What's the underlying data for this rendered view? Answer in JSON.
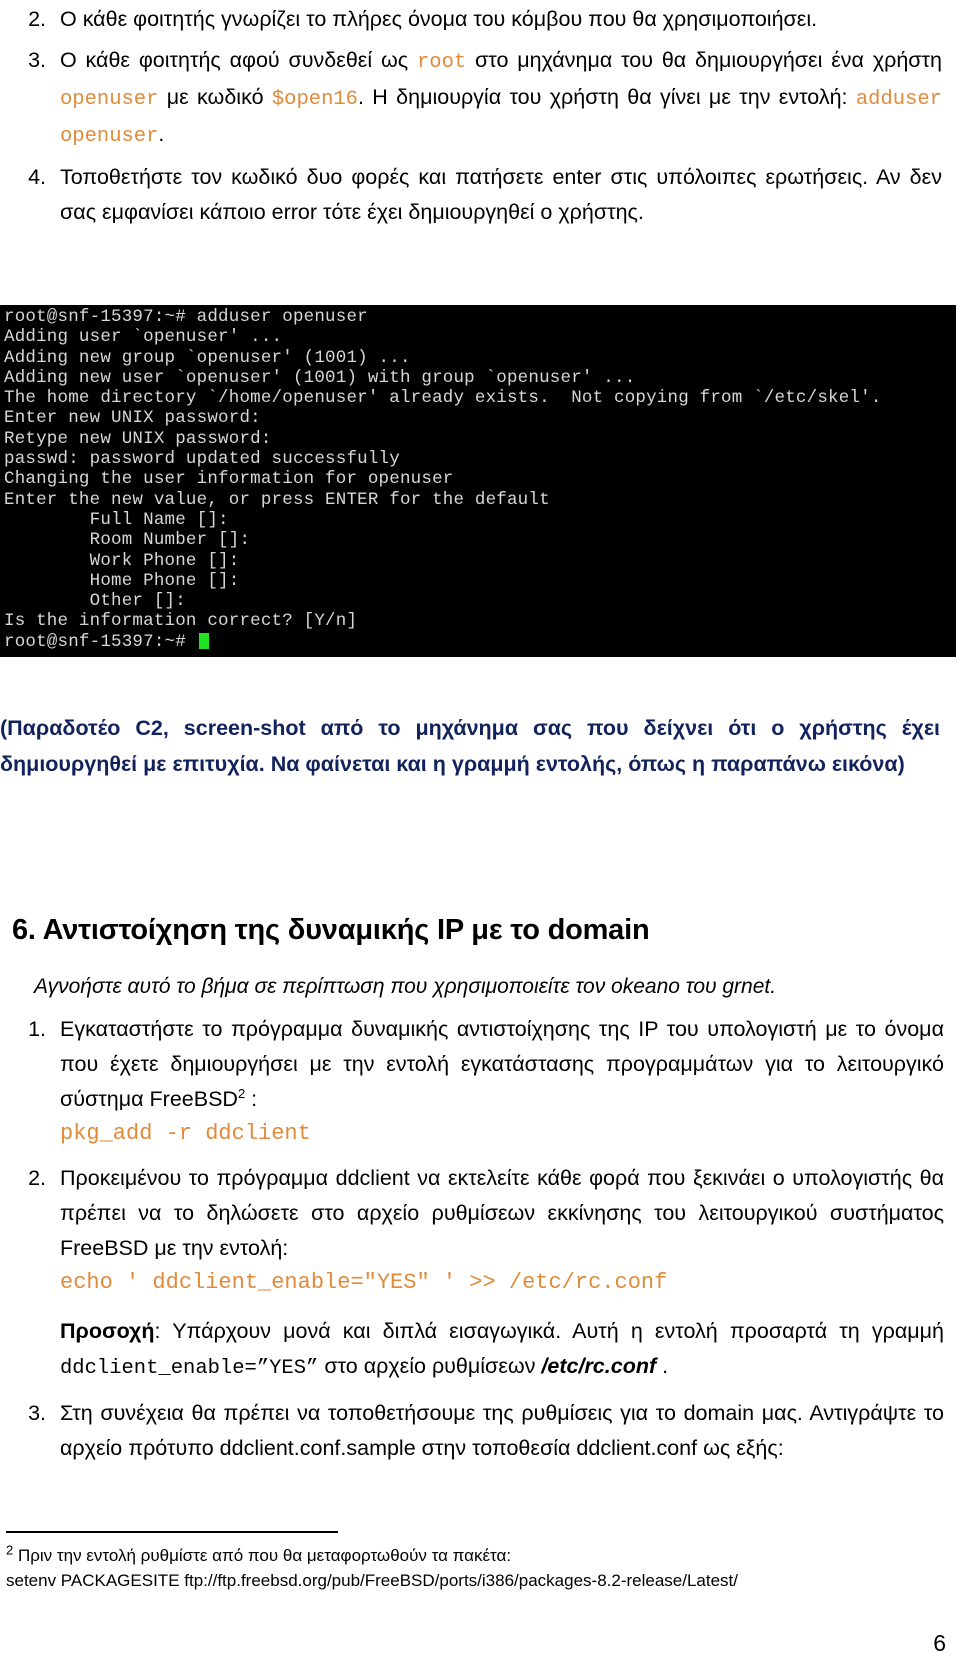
{
  "intro_list": [
    {
      "marker": "2.",
      "parts": [
        {
          "t": "Ο κάθε φοιτητής γνωρίζει το πλήρες όνομα του κόμβου που θα χρησιμοποιήσει.",
          "style": "plain"
        }
      ]
    },
    {
      "marker": "3.",
      "parts": [
        {
          "t": "Ο κάθε φοιτητής αφού συνδεθεί ως ",
          "style": "plain"
        },
        {
          "t": "root",
          "style": "code"
        },
        {
          "t": " στο μηχάνημα του θα δημιουργήσει ένα χρήστη ",
          "style": "plain"
        },
        {
          "t": "openuser",
          "style": "code"
        },
        {
          "t": " με κωδικό ",
          "style": "plain"
        },
        {
          "t": "$open16",
          "style": "code"
        },
        {
          "t": ".  Η δημιουργία του χρήστη θα γίνει με την εντολή: ",
          "style": "plain"
        },
        {
          "t": "adduser openuser",
          "style": "code"
        },
        {
          "t": ".",
          "style": "plain"
        }
      ]
    },
    {
      "marker": "4.",
      "parts": [
        {
          "t": "Τοποθετήστε τον κωδικό δυο φορές και πατήσετε enter στις υπόλοιπες ερωτήσεις. Αν δεν σας εμφανίσει κάποιο error τότε έχει δημιουργηθεί ο χρήστης.",
          "style": "plain"
        }
      ]
    }
  ],
  "terminal": {
    "name": "adduser-terminal-screenshot",
    "background": "#000000",
    "text_color": "#d6d6d6",
    "cursor_color": "#22e322",
    "lines": [
      "root@snf-15397:~# adduser openuser",
      "Adding user `openuser' ...",
      "Adding new group `openuser' (1001) ...",
      "Adding new user `openuser' (1001) with group `openuser' ...",
      "The home directory `/home/openuser' already exists.  Not copying from `/etc/skel'.",
      "Enter new UNIX password:",
      "Retype new UNIX password:",
      "passwd: password updated successfully",
      "Changing the user information for openuser",
      "Enter the new value, or press ENTER for the default",
      "        Full Name []:",
      "        Room Number []:",
      "        Work Phone []:",
      "        Home Phone []:",
      "        Other []:",
      "Is the information correct? [Y/n]"
    ],
    "prompt_line": "root@snf-15397:~# "
  },
  "deliverable": {
    "color": "#12225c",
    "text": "(Παραδοτέο C2, screen-shot από το μηχάνημα σας που δείχνει ότι ο χρήστης έχει δημιουργηθεί με επιτυχία. Να φαίνεται και η γραμμή εντολής, όπως η παραπάνω εικόνα)"
  },
  "section6": {
    "heading": "6. Αντιστοίχηση της δυναμικής IP με το domain",
    "note": "Αγνοήστε αυτό το βήμα σε περίπτωση που χρησιμοποιείτε τον okeano του grnet."
  },
  "steps": [
    {
      "marker": "1.",
      "parts": [
        {
          "t": "Εγκαταστήστε το πρόγραμμα δυναμικής αντιστοίχησης της IP του υπολογιστή με το όνομα που έχετε δημιουργήσει με την εντολή εγκατάστασης προγραμμάτων για το λειτουργικό σύστημα FreeBSD",
          "style": "plain"
        },
        {
          "t": "2",
          "style": "sup"
        },
        {
          "t": " :",
          "style": "plain"
        }
      ],
      "code_block": "pkg_add -r ddclient"
    },
    {
      "marker": "2.",
      "parts": [
        {
          "t": "Προκειμένου το πρόγραμμα ddclient να εκτελείτε κάθε φορά που ξεκινάει ο υπολογιστής θα πρέπει να το δηλώσετε στο αρχείο ρυθμίσεων εκκίνησης του λειτουργικού συστήματος FreeBSD με την εντολή:",
          "style": "plain"
        }
      ],
      "code_block": "echo ' ddclient_enable=\"YES\" ' >> /etc/rc.conf",
      "note_parts": [
        {
          "t": "Προσοχή",
          "style": "bold"
        },
        {
          "t": ": Υπάρχουν μονά και διπλά εισαγωγικά. Αυτή η εντολή προσαρτά τη γραμμή ",
          "style": "plain"
        },
        {
          "t": "ddclient_enable=”YES”",
          "style": "mono-black"
        },
        {
          "t": " στο αρχείο ρυθμίσεων ",
          "style": "plain"
        },
        {
          "t": "/etc/rc.conf",
          "style": "bold-italic"
        },
        {
          "t": " .",
          "style": "plain"
        }
      ]
    },
    {
      "marker": "3.",
      "parts": [
        {
          "t": "Στη συνέχεια θα πρέπει να τοποθετήσουμε της ρυθμίσεις για το domain μας. Αντιγράψτε το αρχείο πρότυπο ddclient.conf.sample στην τοποθεσία ddclient.conf ως εξής:",
          "style": "plain"
        }
      ]
    }
  ],
  "footnote": {
    "marker": "2",
    "line1": " Πριν την εντολή ρυθμίστε από που θα μεταφορτωθούν τα πακέτα:",
    "line2": "setenv PACKAGESITE ftp://ftp.freebsd.org/pub/FreeBSD/ports/i386/packages-8.2-release/Latest/"
  },
  "page_number": "6"
}
